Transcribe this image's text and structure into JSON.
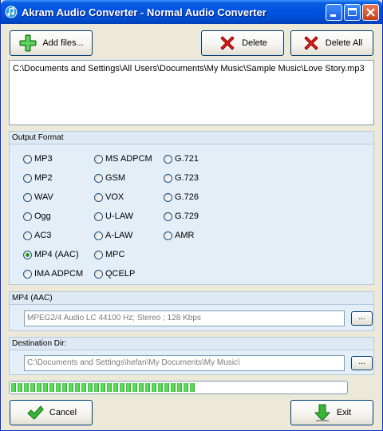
{
  "window": {
    "title": "Akram Audio Converter - Normal Audio Converter",
    "minimize_icon": "minimize-icon",
    "maximize_icon": "maximize-icon",
    "close_icon": "close-icon"
  },
  "toolbar": {
    "add_files_label": "Add files...",
    "delete_label": "Delete",
    "delete_all_label": "Delete All",
    "add_icon": "plus-icon",
    "delete_icon": "red-x-icon"
  },
  "file_list": {
    "items": [
      "C:\\Documents and Settings\\All Users\\Documents\\My Music\\Sample Music\\Love Story.mp3"
    ]
  },
  "output_format": {
    "title": "Output Format",
    "selected": "MP4 (AAC)",
    "col1": [
      "MP3",
      "MP2",
      "WAV",
      "Ogg",
      "AC3",
      "MP4 (AAC)",
      "IMA ADPCM"
    ],
    "col2": [
      "MS ADPCM",
      "GSM",
      "VOX",
      "U-LAW",
      "A-LAW",
      "MPC",
      "QCELP"
    ],
    "col3": [
      "G.721",
      "G.723",
      "G.726",
      "G.729",
      "AMR"
    ]
  },
  "format_settings": {
    "title": "MP4 (AAC)",
    "value": "MPEG2/4 Audio LC 44100 Hz; Stereo ; 128 Kbps",
    "browse_label": "..."
  },
  "destination": {
    "title": "Destination Dir:",
    "value": "C:\\Documents and Settings\\hefan\\My Documents\\My Music\\",
    "browse_label": "..."
  },
  "progress": {
    "fraction": 0.55
  },
  "footer": {
    "cancel_label": "Cancel",
    "exit_label": "Exit",
    "cancel_icon": "green-check-icon",
    "exit_icon": "green-down-arrow-icon"
  }
}
